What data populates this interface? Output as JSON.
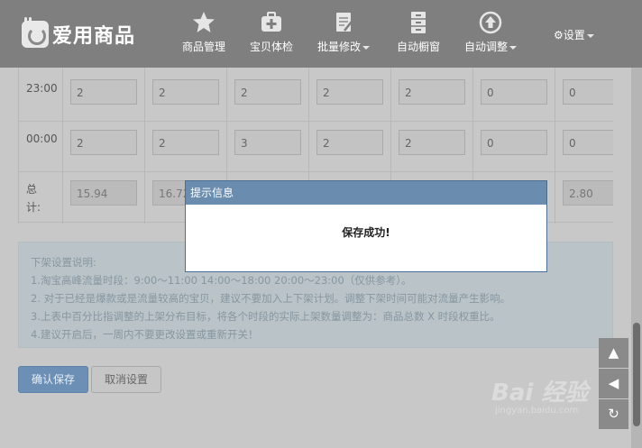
{
  "header": {
    "logo_text": "爱用商品",
    "nav": [
      {
        "label": "商品管理",
        "icon": "star-icon",
        "has_caret": false
      },
      {
        "label": "宝贝体检",
        "icon": "medkit-icon",
        "has_caret": false
      },
      {
        "label": "批量修改",
        "icon": "edit-doc-icon",
        "has_caret": true
      },
      {
        "label": "自动橱窗",
        "icon": "cabinet-icon",
        "has_caret": false
      },
      {
        "label": "自动调整",
        "icon": "upload-circle-icon",
        "has_caret": true
      }
    ],
    "settings_label": "设置"
  },
  "schedule": {
    "rows": [
      {
        "label": "23:00",
        "values": [
          "2",
          "2",
          "2",
          "2",
          "2",
          "0",
          "0"
        ]
      },
      {
        "label": "00:00",
        "values": [
          "2",
          "2",
          "3",
          "2",
          "2",
          "0",
          "0"
        ]
      }
    ],
    "total": {
      "label_line1": "总",
      "label_line2": "计:",
      "values": [
        "15.94",
        "16.72",
        "",
        "",
        "",
        "",
        "2.80"
      ]
    }
  },
  "notes": {
    "title": "下架设置说明:",
    "items": [
      "1.淘宝高峰流量时段：9:00～11:00 14:00～18:00 20:00～23:00（仅供参考）。",
      "2. 对于已经是爆款或是流量较高的宝贝，建议不要加入上下架计划。调整下架时间可能对流量产生影响。",
      "3.上表中百分比指调整的上架分布目标，将各个时段的实际上架数量调整为：商品总数 X 时段权重比。",
      "4.建议开启后，一周内不要更改设置或重新开关！"
    ]
  },
  "buttons": {
    "confirm": "确认保存",
    "cancel": "取消设置"
  },
  "fabs": {
    "up": "▲",
    "back": "◀",
    "refresh": "↻"
  },
  "watermark": {
    "main": "Bai 经验",
    "sub": "jingyan.baidu.com"
  },
  "modal": {
    "title": "提示信息",
    "message": "保存成功!"
  }
}
